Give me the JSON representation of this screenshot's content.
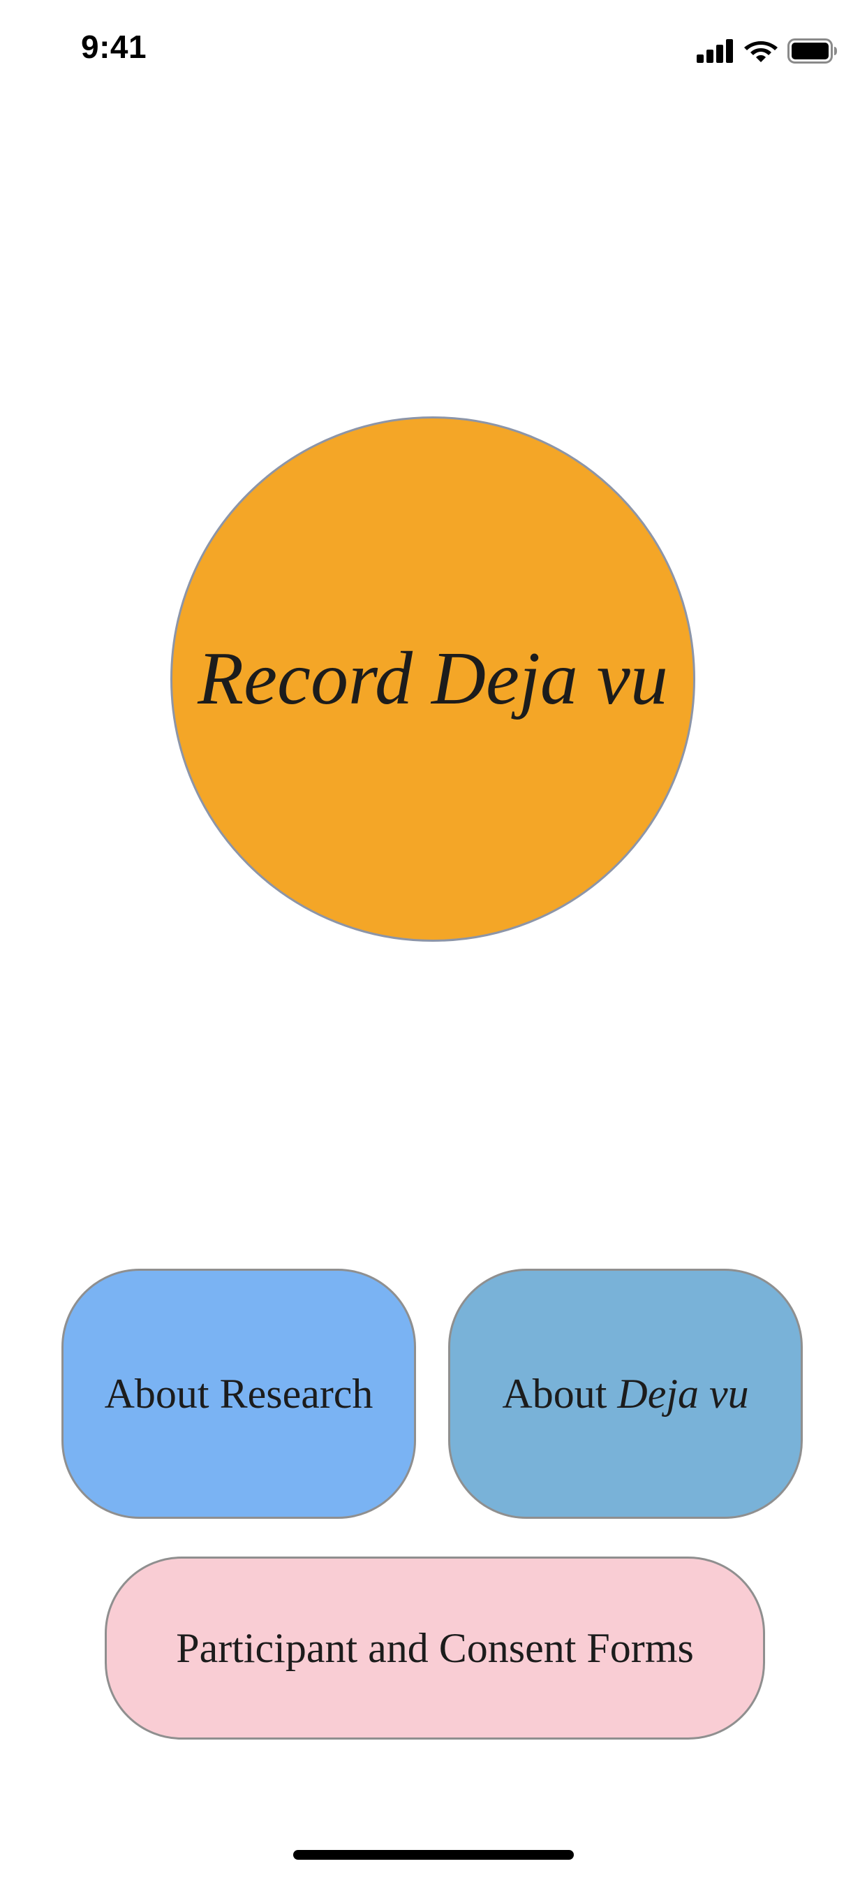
{
  "status_bar": {
    "time": "9:41",
    "signal_icon": "cellular-signal-icon",
    "wifi_icon": "wifi-icon",
    "battery_icon": "battery-icon"
  },
  "record": {
    "label": "Record Deja vu",
    "color": "#F4A627"
  },
  "buttons": {
    "about_research": {
      "label": "About Research",
      "color": "#7AB3F3"
    },
    "about_dejavu": {
      "label_prefix": "About ",
      "label_italic": "Deja vu",
      "color": "#79B2D8"
    },
    "forms": {
      "label": "Participant and Consent Forms",
      "color": "#F9CDD4"
    }
  },
  "home_indicator_color": "#000000"
}
